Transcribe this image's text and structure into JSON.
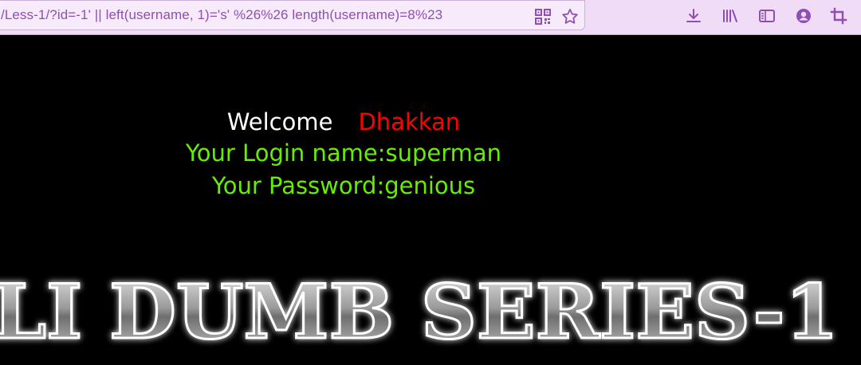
{
  "browser": {
    "url": "/Less-1/?id=-1' || left(username, 1)='s' %26%26 length(username)=8%23",
    "accent": "#8e4fb5",
    "toolbar_bg": "#f0dcf6",
    "icons": [
      "qr-code-icon",
      "bookmark-star-icon",
      "download-icon",
      "library-icon",
      "sidebar-icon",
      "account-icon",
      "crop-icon"
    ]
  },
  "page": {
    "background": "#000000",
    "welcome_label": "Welcome",
    "welcome_name": "Dhakkan",
    "login_line": "Your Login name:superman",
    "password_line": "Your Password:genious",
    "banner_text": "LI DUMB SERIES-1",
    "colors": {
      "welcome": "#ffffff",
      "name": "#ff0000",
      "info": "#66ee00"
    }
  }
}
